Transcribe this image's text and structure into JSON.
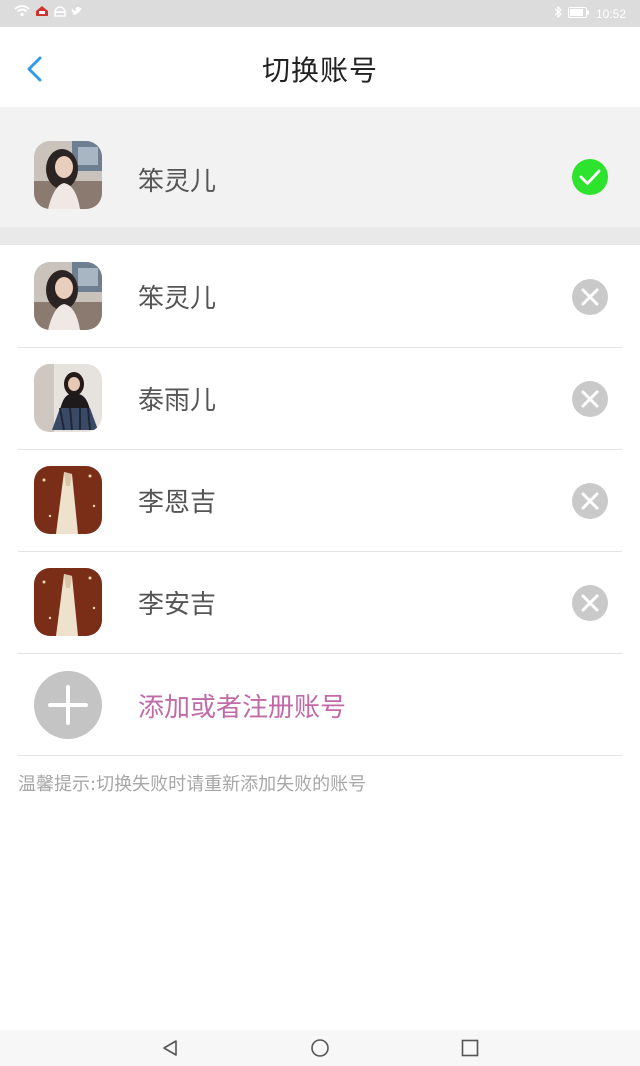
{
  "status_bar": {
    "time": "10:52",
    "left_icons": [
      "wifi-icon",
      "notification-icon",
      "android-icon",
      "twitter-icon"
    ],
    "right_icons": [
      "bluetooth-icon",
      "battery-icon"
    ]
  },
  "header": {
    "title": "切换账号",
    "back_icon": "chevron-left-icon"
  },
  "current_account": {
    "name": "笨灵儿",
    "status_icon": "check-circle-icon",
    "status_color": "#2ee32e"
  },
  "accounts": [
    {
      "name": "笨灵儿",
      "action_icon": "remove-icon"
    },
    {
      "name": "泰雨儿",
      "action_icon": "remove-icon"
    },
    {
      "name": "李恩吉",
      "action_icon": "remove-icon"
    },
    {
      "name": "李安吉",
      "action_icon": "remove-icon"
    }
  ],
  "add_account": {
    "label": "添加或者注册账号",
    "icon": "plus-icon",
    "color": "#c06aa7"
  },
  "hint": "温馨提示:切换失败时请重新添加失败的账号",
  "nav_bar": [
    "back-nav-icon",
    "home-nav-icon",
    "recents-nav-icon"
  ],
  "colors": {
    "accent_blue": "#2f9bea",
    "check_green": "#2ee32e",
    "remove_gray": "#c9c9c9"
  }
}
